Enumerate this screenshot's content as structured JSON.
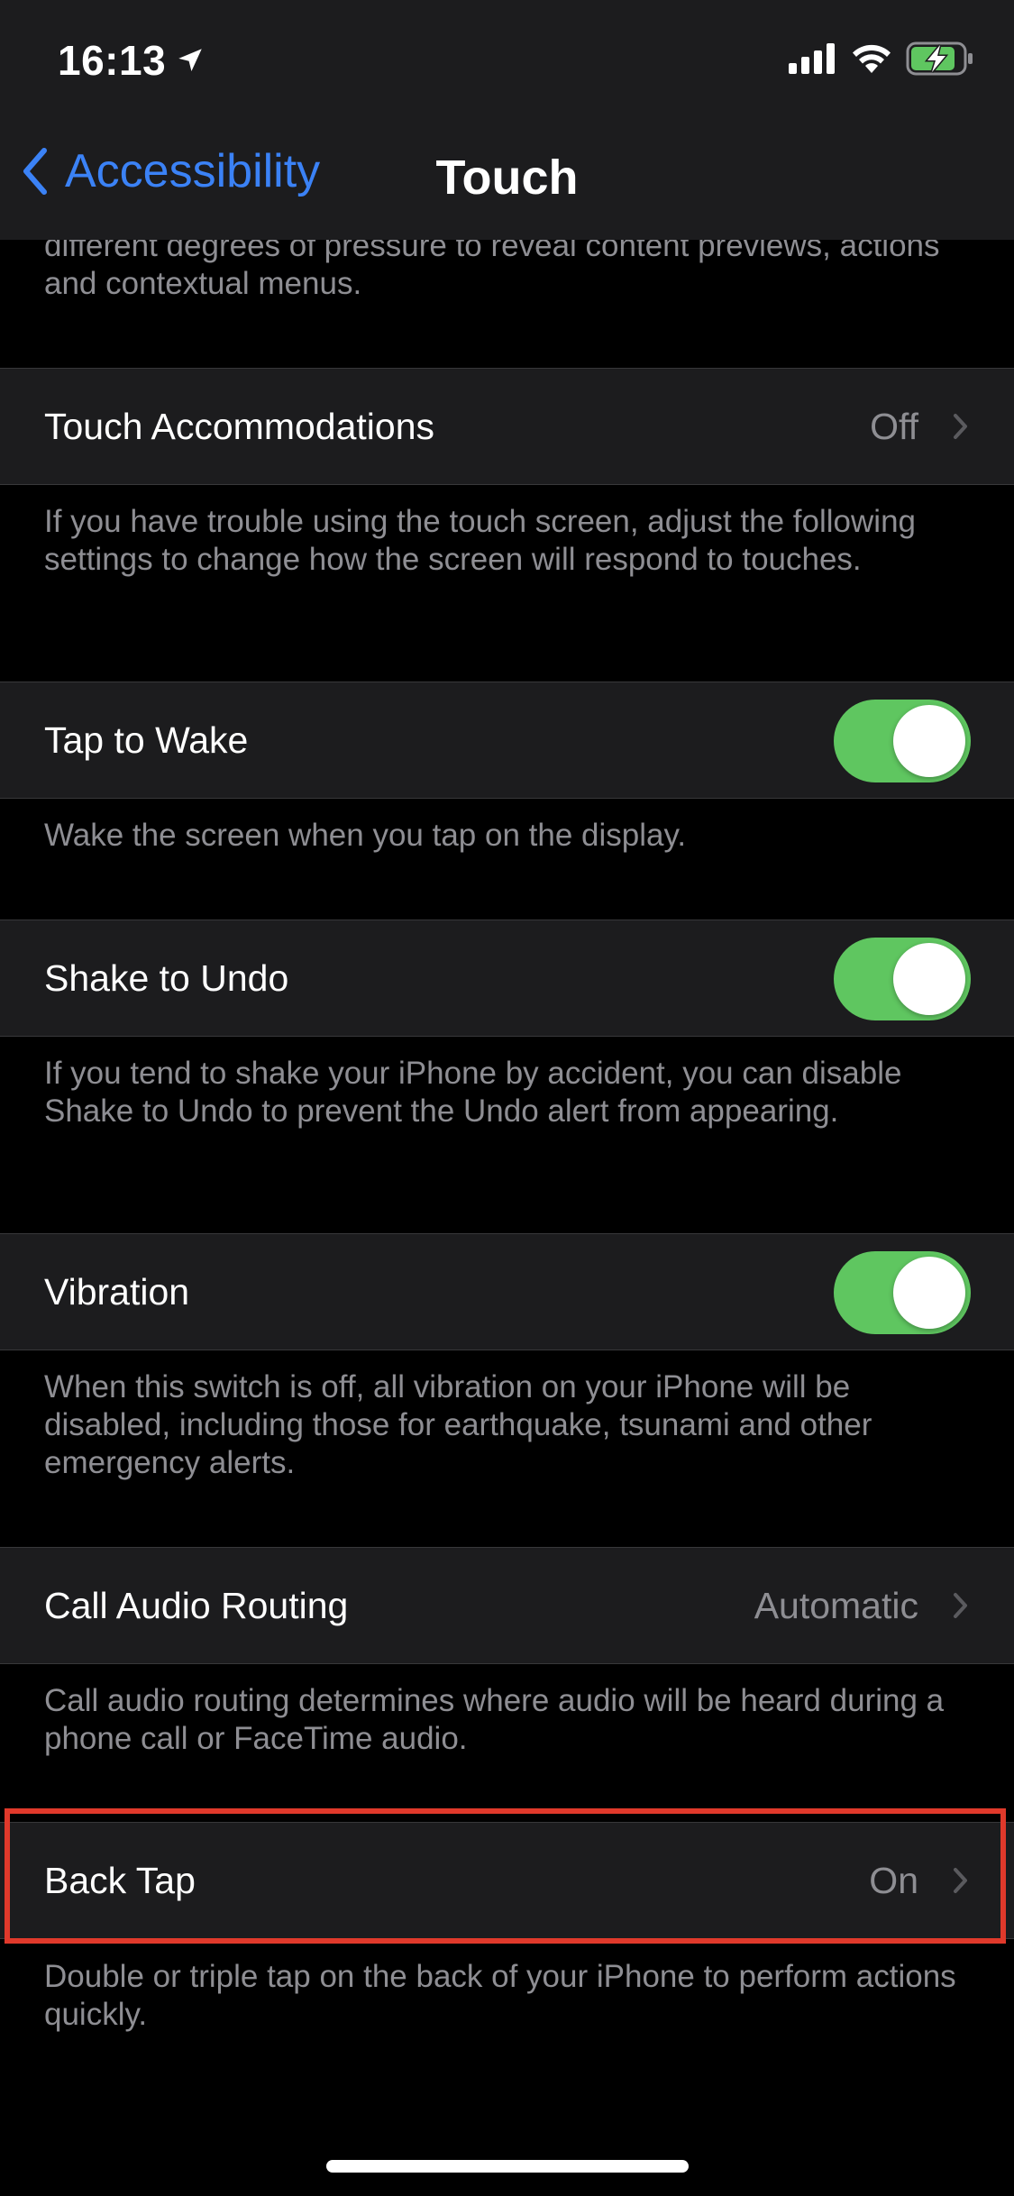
{
  "status_bar": {
    "time": "16:13",
    "location_icon": "location-arrow-icon",
    "signal_icon": "cellular-signal-icon",
    "wifi_icon": "wifi-icon",
    "battery_icon": "battery-charging-icon"
  },
  "nav": {
    "back_label": "Accessibility",
    "title": "Touch"
  },
  "sections": {
    "top_partial_footer": "different degrees of pressure to reveal content previews, actions and contextual menus.",
    "touch_accommodations": {
      "label": "Touch Accommodations",
      "value": "Off",
      "footer": "If you have trouble using the touch screen, adjust the following settings to change how the screen will respond to touches."
    },
    "tap_to_wake": {
      "label": "Tap to Wake",
      "enabled": true,
      "footer": "Wake the screen when you tap on the display."
    },
    "shake_to_undo": {
      "label": "Shake to Undo",
      "enabled": true,
      "footer": "If you tend to shake your iPhone by accident, you can disable Shake to Undo to prevent the Undo alert from appearing."
    },
    "vibration": {
      "label": "Vibration",
      "enabled": true,
      "footer": "When this switch is off, all vibration on your iPhone will be disabled, including those for earthquake, tsunami and other emergency alerts."
    },
    "call_audio_routing": {
      "label": "Call Audio Routing",
      "value": "Automatic",
      "footer": "Call audio routing determines where audio will be heard during a phone call or FaceTime audio."
    },
    "back_tap": {
      "label": "Back Tap",
      "value": "On",
      "footer": "Double or triple tap on the back of your iPhone to perform actions quickly."
    }
  },
  "colors": {
    "accent": "#3b82f6",
    "toggle_on": "#5fc660",
    "highlight": "#e0392b",
    "cell_background": "#1c1c1e",
    "secondary_text": "#8e8e93"
  }
}
